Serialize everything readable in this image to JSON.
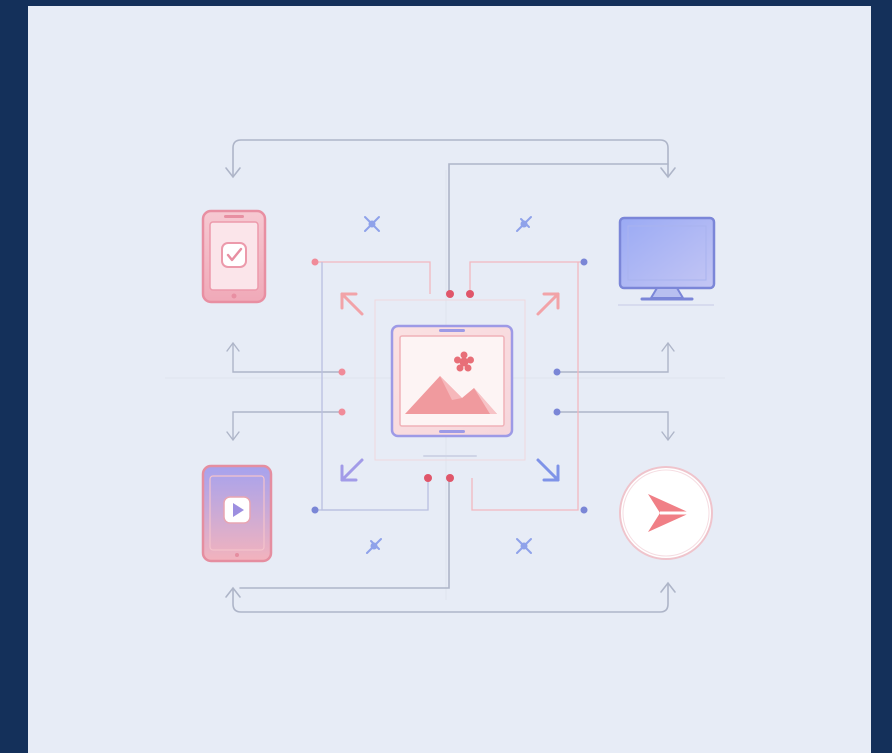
{
  "diagram": {
    "theme": {
      "frame": "#14305a",
      "panel": "#e7ecf6",
      "pink": "#f0a6b4",
      "pink_dark": "#e58ea0",
      "coral": "#ee8486",
      "blue": "#8d9ef2",
      "purple": "#a29be8",
      "line": "#aeb5c8",
      "dot_red": "#e0566a",
      "dot_blue": "#7a86d6"
    },
    "nodes": [
      {
        "id": "phone",
        "icon": "smartphone-check-icon"
      },
      {
        "id": "monitor",
        "icon": "desktop-monitor-icon"
      },
      {
        "id": "tablet",
        "icon": "tablet-play-icon"
      },
      {
        "id": "share",
        "icon": "share-arrow-icon"
      },
      {
        "id": "center",
        "icon": "image-frame-icon"
      }
    ]
  }
}
